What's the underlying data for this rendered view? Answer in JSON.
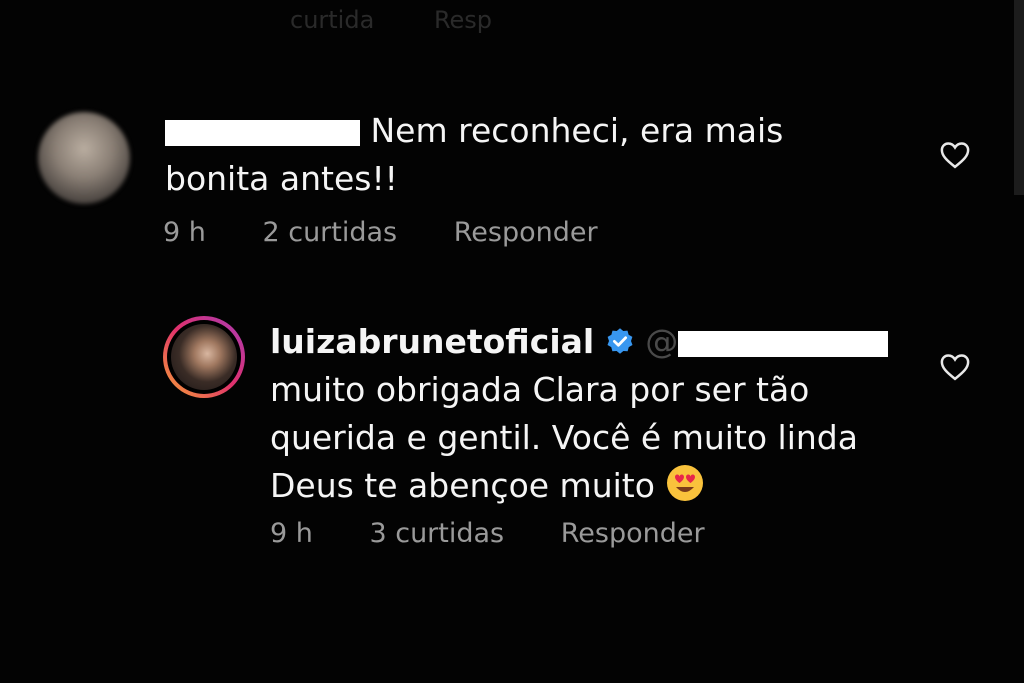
{
  "top": {
    "likes_faded": "curtida",
    "reply_faded": "Resp"
  },
  "comments": [
    {
      "text_line1": "Nem reconheci, era mais",
      "text_line2": "bonita antes!!",
      "time": "9 h",
      "likes": "2 curtidas",
      "reply": "Responder"
    },
    {
      "username": "luizabrunetoficial",
      "line1": "muito obrigada Clara por ser tão",
      "line2": "querida e gentil. Você é muito linda",
      "line3": "Deus te abençoe muito",
      "time": "9 h",
      "likes": "3 curtidas",
      "reply": "Responder"
    }
  ],
  "icons": {
    "heart": "heart-outline-icon",
    "verified": "verified-badge-icon",
    "emoji": "heart-eyes-emoji"
  },
  "colors": {
    "background": "#030303",
    "text": "#f5f5f5",
    "meta": "#9a9a9a",
    "verified": "#3897f0",
    "redaction": "#ffffff"
  }
}
